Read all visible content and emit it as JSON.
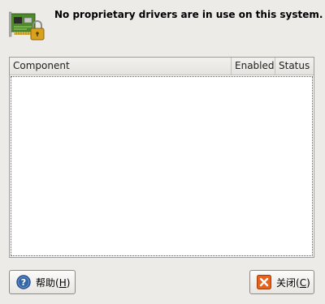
{
  "header": {
    "message": "No proprietary drivers are in use on this system."
  },
  "table": {
    "columns": {
      "component": "Component",
      "enabled": "Enabled",
      "status": "Status"
    },
    "rows": []
  },
  "buttons": {
    "help": {
      "label": "帮助(",
      "mnemonic": "H",
      "suffix": ")"
    },
    "close": {
      "label": "关闭(",
      "mnemonic": "C",
      "suffix": ")"
    }
  },
  "icons": {
    "header": "hardware-card-lock-icon",
    "help": "help-icon",
    "close": "close-icon"
  },
  "colors": {
    "window_bg": "#edebe8",
    "card_green": "#4e8a2a",
    "lock_gold": "#d9a21c",
    "help_blue": "#3465a4",
    "close_orange": "#e8621c"
  }
}
